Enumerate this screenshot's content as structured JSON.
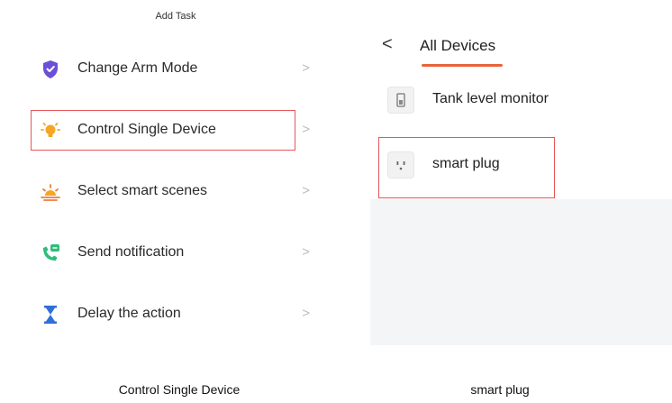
{
  "left_panel": {
    "title": "Add Task",
    "items": [
      {
        "label": "Change Arm Mode",
        "icon": "shield-icon"
      },
      {
        "label": "Control Single Device",
        "icon": "bulb-icon"
      },
      {
        "label": "Select smart scenes",
        "icon": "sunrise-icon"
      },
      {
        "label": "Send notification",
        "icon": "phone-message-icon"
      },
      {
        "label": "Delay the action",
        "icon": "hourglass-icon"
      }
    ],
    "chevron": ">"
  },
  "right_panel": {
    "back": "<",
    "title": "All Devices",
    "devices": [
      {
        "label": "Tank level monitor",
        "icon": "tank-monitor-icon"
      },
      {
        "label": "smart plug",
        "icon": "smart-plug-icon"
      }
    ]
  },
  "captions": {
    "left": "Control Single Device",
    "right": "smart plug"
  },
  "colors": {
    "highlight": "#e4575b",
    "accent": "#e8643a",
    "shield": "#6b4fd8",
    "bulb": "#f5a623",
    "notification": "#2dbd7a",
    "hourglass": "#2f6fd6"
  }
}
